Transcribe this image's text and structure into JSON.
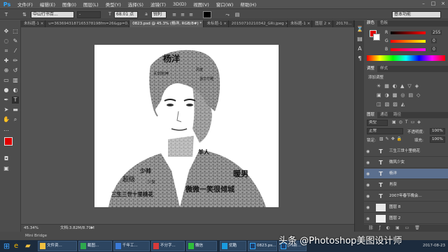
{
  "app": {
    "logo": "Ps"
  },
  "menubar": {
    "items": [
      "文件(F)",
      "编辑(E)",
      "图像(I)",
      "图层(L)",
      "类型(Y)",
      "选择(S)",
      "滤镜(T)",
      "3D(D)",
      "视图(V)",
      "窗口(W)",
      "帮助(H)"
    ],
    "window_controls": [
      "–",
      "□",
      "×"
    ]
  },
  "options": {
    "font_family": "中山行书百...",
    "font_style": "-",
    "font_size": "68.01 点",
    "aa_label": "a",
    "aa_value": "锐利",
    "workspace": "基本功能"
  },
  "tabs": [
    {
      "label": "未标题-1 ×"
    },
    {
      "label": "u=3636943187165378198fm=26&gp=0.jpg ×"
    },
    {
      "label": "0823.psd @ 45.3% (杨洋, RGB/8#) * ×",
      "active": true
    },
    {
      "label": "未标题-1 ×"
    },
    {
      "label": "20150710210342_GRi.jpeg ×"
    },
    {
      "label": "未标题-1 ×"
    },
    {
      "label": "图层 2 ×"
    },
    {
      "label": "20170..."
    }
  ],
  "tools": [
    "move",
    "marquee",
    "lasso",
    "quick-select",
    "crop",
    "eyedropper",
    "healing",
    "brush",
    "clone",
    "history",
    "eraser",
    "gradient",
    "blur",
    "dodge",
    "pen",
    "type",
    "path-select",
    "shape",
    "hand",
    "zoom"
  ],
  "colors": {
    "foreground": "#e00000",
    "background": "#ffffff",
    "accent": "#5b6f8e"
  },
  "artwork": {
    "texts": [
      "杨洋",
      "天剑豹神",
      "风度",
      "温文尔雅",
      "少帅",
      "羊人",
      "暖男",
      "超级",
      "少女",
      "微微一笑很倾城",
      "三生三世十里桃花"
    ]
  },
  "status": {
    "zoom": "45.34%",
    "doc": "文档:3.82M/8.79M"
  },
  "color_panel": {
    "tabs": [
      "颜色",
      "色板"
    ],
    "r_label": "R",
    "r_value": "255",
    "g_label": "G",
    "g_value": "0",
    "b_label": "B",
    "b_value": "0"
  },
  "adjust_panel": {
    "tabs": [
      "调整",
      "样式"
    ],
    "hint": "添加调整"
  },
  "layers_panel": {
    "tabs": [
      "图层",
      "通道",
      "路径"
    ],
    "filter": "类型",
    "blend_mode": "正常",
    "opacity_label": "不透明度:",
    "opacity_value": "100%",
    "lock_label": "锁定:",
    "fill_label": "填充:",
    "fill_value": "100%",
    "layers": [
      {
        "thumb": "T",
        "name": "三生三世十里桃花",
        "selected": false
      },
      {
        "thumb": "T",
        "name": "微风少女",
        "selected": false
      },
      {
        "thumb": "T",
        "name": "杨洋",
        "selected": true
      },
      {
        "thumb": "T",
        "name": "肖奈",
        "selected": false
      },
      {
        "thumb": "T",
        "name": "2007年春节晚会...",
        "selected": false
      },
      {
        "thumb": "",
        "name": "图层 8",
        "selected": false
      },
      {
        "thumb": "",
        "name": "图层 2",
        "selected": false
      }
    ]
  },
  "mini_bridge": "Mini Bridge",
  "taskbar": {
    "buttons": [
      "文件资...",
      "截图...",
      "千年工...",
      "不分字...",
      "微信",
      "优酷",
      "0823.ps...",
      "[Ps新..."
    ],
    "clock_time": "",
    "clock_date": "2017-08-23"
  },
  "watermark": "头条 @Photoshop美图设计师"
}
